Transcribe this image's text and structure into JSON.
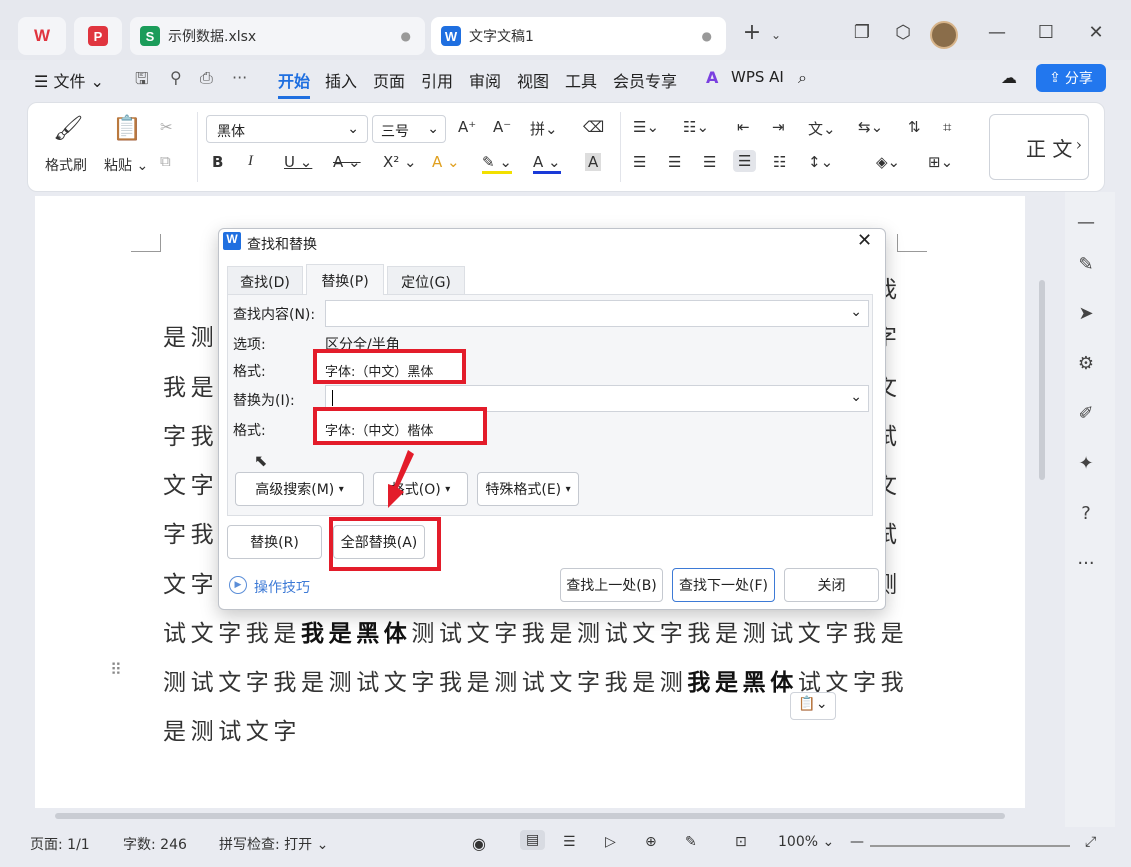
{
  "tabs": {
    "wps_logo": "WPS",
    "tab2_icon": "P",
    "sheet_icon": "S",
    "sheet_name": "示例数据.xlsx",
    "doc_icon": "W",
    "doc_name": "文字文稿1",
    "new_tab": "+"
  },
  "menubar": {
    "file": "文件",
    "items": [
      "开始",
      "插入",
      "页面",
      "引用",
      "审阅",
      "视图",
      "工具",
      "会员专享"
    ],
    "wps_ai": "WPS AI",
    "share": "分享"
  },
  "ribbon": {
    "format_painter": "格式刷",
    "paste": "粘贴",
    "font_name": "黑体",
    "font_size": "三号",
    "style_preview": "正 文"
  },
  "document": {
    "lines": [
      {
        "pre": "是测",
        "bold": "",
        "post": ""
      },
      {
        "pre": "我是",
        "bold": "",
        "post": ""
      },
      {
        "pre": "字我",
        "bold": "",
        "post": ""
      },
      {
        "pre": "文字",
        "bold": "",
        "post": ""
      },
      {
        "pre": "字我",
        "bold": "",
        "post": ""
      },
      {
        "pre": "文字",
        "bold": "",
        "post": ""
      },
      {
        "pre": "试文字我是",
        "bold": "我是黑体",
        "post": "测试文字我是测试文字我是测试文字我是"
      },
      {
        "pre": "测试文字我是测试文字我是测试文字我是测",
        "bold": "我是黑体",
        "post": "试文字我"
      },
      {
        "pre": "是测试文字",
        "bold": "",
        "post": ""
      }
    ],
    "right_edge_chars": [
      "我",
      "字",
      "文",
      "试",
      "文",
      "试",
      "试",
      "测"
    ]
  },
  "dialog": {
    "title": "查找和替换",
    "tabs": [
      "查找(D)",
      "替换(P)",
      "定位(G)"
    ],
    "active_tab": "替换(P)",
    "find_label": "查找内容(N):",
    "find_value": "",
    "options_label": "选项:",
    "options_value": "区分全/半角",
    "format_label": "格式:",
    "find_format": "字体:（中文）黑体",
    "replace_label": "替换为(I):",
    "replace_value": "",
    "replace_format_label": "格式:",
    "replace_format": "字体:（中文）楷体",
    "advanced_search": "高级搜索(M)",
    "format_button": "格式(O)",
    "special_format": "特殊格式(E)",
    "replace_button": "替换(R)",
    "replace_all_button": "全部替换(A)",
    "tips": "操作技巧",
    "find_prev": "查找上一处(B)",
    "find_next": "查找下一处(F)",
    "close": "关闭",
    "highlight_color": "#e31c2a"
  },
  "statusbar": {
    "page": "页面: 1/1",
    "words": "字数: 246",
    "spell": "拼写检查: 打开",
    "zoom": "100%"
  },
  "colors": {
    "accent": "#1f6fe0",
    "share_bg": "#2277ee",
    "sheet_green": "#1b9c5a",
    "wps_red": "#e0353f"
  }
}
